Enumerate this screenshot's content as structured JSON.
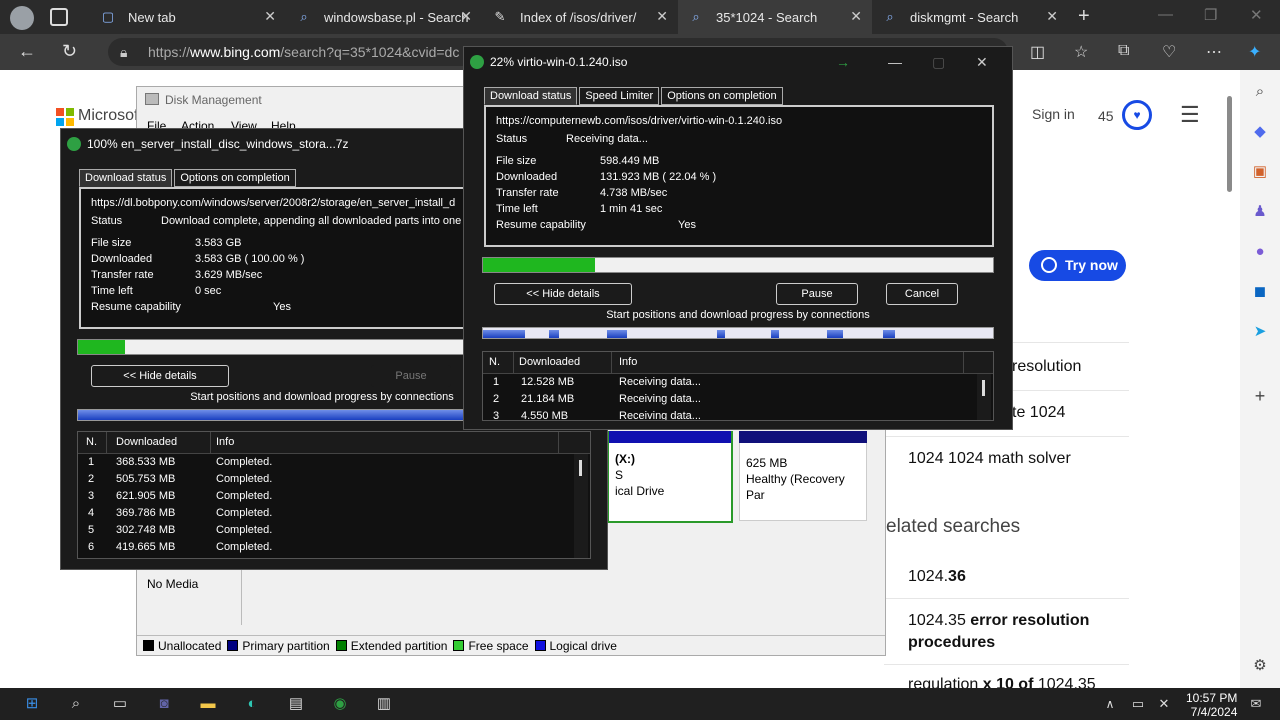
{
  "browser": {
    "tabs": [
      {
        "title": "New tab",
        "icon": "new-tab-icon"
      },
      {
        "title": "windowsbase.pl - Search",
        "icon": "search-icon"
      },
      {
        "title": "Index of /isos/driver/",
        "icon": "page-icon"
      },
      {
        "title": "35*1024 - Search",
        "icon": "search-icon",
        "active": true
      },
      {
        "title": "diskmgmt - Search",
        "icon": "search-icon"
      }
    ],
    "url_prefix": "https://",
    "url_host": "www.bing.com",
    "url_path": "/search?q=35*1024&cvid=dc"
  },
  "bing": {
    "brand": "Microsoft Bing",
    "sign_in": "Sign in",
    "points": "45",
    "try_now": "Try now",
    "results": [
      "resolution",
      "te 1024",
      "1024 1024 math solver"
    ],
    "related_heading": "elated searches",
    "related": [
      {
        "plain": "1024.",
        "bold": "36"
      },
      {
        "plain": "1024.35 ",
        "bold": "error resolution"
      },
      {
        "plain": "",
        "bold": "procedures"
      },
      {
        "plain": "regulation ",
        "bold": "x 10 of ",
        "tail": "1024.35"
      }
    ]
  },
  "disk_management": {
    "title": "Disk Management",
    "menu": [
      "File",
      "Action",
      "View",
      "Help"
    ],
    "volumes": [
      {
        "line1": "(X:)",
        "line2": "S",
        "line3": "ical Drive"
      },
      {
        "line1": "625 MB",
        "line2": "Healthy (Recovery Par",
        "line3": ""
      }
    ],
    "no_media": "No Media",
    "legend": [
      {
        "label": "Unallocated",
        "color": "#000000"
      },
      {
        "label": "Primary partition",
        "color": "#000080"
      },
      {
        "label": "Extended partition",
        "color": "#008000"
      },
      {
        "label": "Free space",
        "color": "#33cc33"
      },
      {
        "label": "Logical drive",
        "color": "#1010e0"
      }
    ]
  },
  "idm_back": {
    "title": "100% en_server_install_disc_windows_stora...7z",
    "tabs": [
      "Download status",
      "Options on completion"
    ],
    "url": "https://dl.bobpony.com/windows/server/2008r2/storage/en_server_install_d",
    "status_label": "Status",
    "status": "Download complete, appending all downloaded parts into one f",
    "file_size_label": "File size",
    "file_size": "3.583  GB",
    "downloaded_label": "Downloaded",
    "downloaded": "3.583  GB  ( 100.00 % )",
    "rate_label": "Transfer rate",
    "rate": "3.629  MB/sec",
    "time_label": "Time left",
    "time_left": "0 sec",
    "resume_label": "Resume capability",
    "resume": "Yes",
    "progress_percent": 100,
    "hide_details": "<< Hide details",
    "pause": "Pause",
    "connections_label": "Start positions and download progress by connections",
    "table_headers": [
      "N.",
      "Downloaded",
      "Info"
    ],
    "rows": [
      {
        "n": "1",
        "downloaded": "368.533  MB",
        "info": "Completed."
      },
      {
        "n": "2",
        "downloaded": "505.753  MB",
        "info": "Completed."
      },
      {
        "n": "3",
        "downloaded": "621.905  MB",
        "info": "Completed."
      },
      {
        "n": "4",
        "downloaded": "369.786  MB",
        "info": "Completed."
      },
      {
        "n": "5",
        "downloaded": "302.748  MB",
        "info": "Completed."
      },
      {
        "n": "6",
        "downloaded": "419.665  MB",
        "info": "Completed."
      }
    ]
  },
  "idm_front": {
    "title": "22% virtio-win-0.1.240.iso",
    "tabs": [
      "Download status",
      "Speed Limiter",
      "Options on completion"
    ],
    "url": "https://computernewb.com/isos/driver/virtio-win-0.1.240.iso",
    "status_label": "Status",
    "status": "Receiving data...",
    "file_size_label": "File size",
    "file_size": "598.449  MB",
    "downloaded_label": "Downloaded",
    "downloaded": "131.923  MB  ( 22.04 % )",
    "rate_label": "Transfer rate",
    "rate": "4.738  MB/sec",
    "time_label": "Time left",
    "time_left": "1 min 41 sec",
    "resume_label": "Resume capability",
    "resume": "Yes",
    "progress_percent": 22.04,
    "hide_details": "<< Hide details",
    "pause": "Pause",
    "cancel": "Cancel",
    "connections_label": "Start positions and download progress by connections",
    "table_headers": [
      "N.",
      "Downloaded",
      "Info"
    ],
    "rows": [
      {
        "n": "1",
        "downloaded": "12.528  MB",
        "info": "Receiving data..."
      },
      {
        "n": "2",
        "downloaded": "21.184  MB",
        "info": "Receiving data..."
      },
      {
        "n": "3",
        "downloaded": "4.550  MB",
        "info": "Receiving data..."
      }
    ]
  },
  "taskbar": {
    "time": "10:57 PM",
    "date": "7/4/2024"
  }
}
